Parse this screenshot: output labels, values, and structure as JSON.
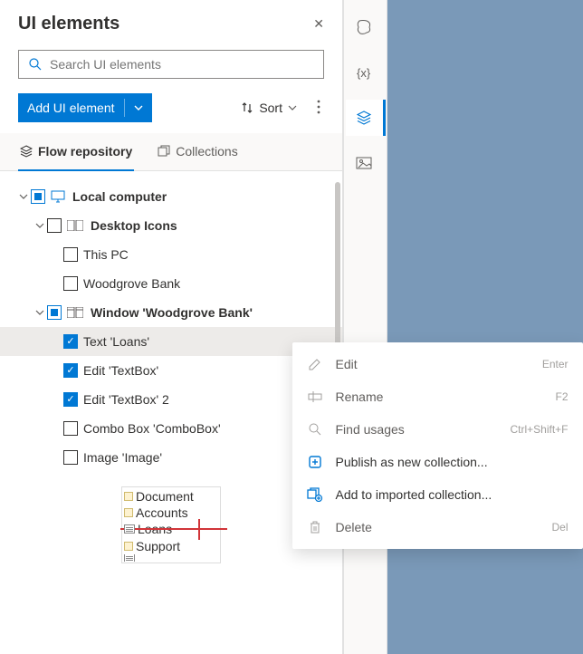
{
  "header": {
    "title": "UI elements"
  },
  "search": {
    "placeholder": "Search UI elements"
  },
  "toolbar": {
    "add_label": "Add UI element",
    "sort_label": "Sort"
  },
  "tabs": {
    "flow": "Flow repository",
    "collections": "Collections"
  },
  "tree": {
    "root": "Local computer",
    "desktop": "Desktop Icons",
    "thispc": "This PC",
    "wbank": "Woodgrove Bank",
    "win": "Window 'Woodgrove Bank'",
    "loans": "Text 'Loans'",
    "tb1": "Edit 'TextBox'",
    "tb2": "Edit 'TextBox' 2",
    "combo": "Combo Box 'ComboBox'",
    "image": "Image 'Image'"
  },
  "preview": {
    "r1": "Document",
    "r2": "Accounts",
    "r3": "Loans",
    "r4": "Support"
  },
  "context_menu": {
    "edit": {
      "label": "Edit",
      "shortcut": "Enter"
    },
    "rename": {
      "label": "Rename",
      "shortcut": "F2"
    },
    "find": {
      "label": "Find usages",
      "shortcut": "Ctrl+Shift+F"
    },
    "publish": {
      "label": "Publish as new collection..."
    },
    "addimp": {
      "label": "Add to imported collection..."
    },
    "delete": {
      "label": "Delete",
      "shortcut": "Del"
    }
  }
}
